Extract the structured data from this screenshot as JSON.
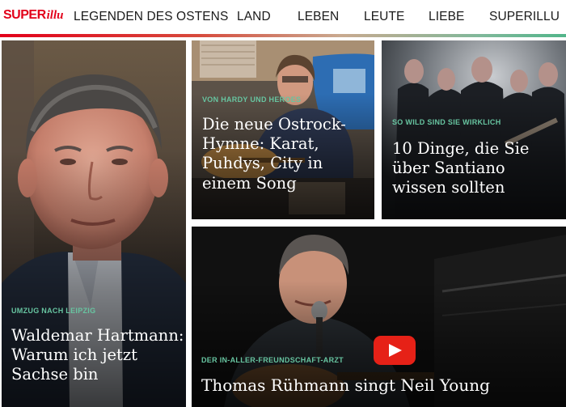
{
  "brand": {
    "part1": "SUPER",
    "part2": "illu"
  },
  "nav": {
    "items": [
      {
        "label": "LEGENDEN DES OSTENS"
      },
      {
        "label": "LAND"
      },
      {
        "label": "LEBEN"
      },
      {
        "label": "LEUTE"
      },
      {
        "label": "LIEBE"
      },
      {
        "label": "SUPERILLU"
      }
    ]
  },
  "teasers": [
    {
      "kicker": "UMZUG NACH LEIPZIG",
      "headline": "Waldemar Hartmann: Warum ich jetzt Sachse bin"
    },
    {
      "kicker": "VON HARDY UND HEROES",
      "headline": "Die neue Ostrock-Hymne: Karat, Puhdys, City in einem Song"
    },
    {
      "kicker": "SO WILD SIND SIE WIRKLICH",
      "headline": "10 Dinge, die Sie über Santiano wissen sollten"
    },
    {
      "kicker": "DER IN-ALLER-FREUNDSCHAFT-ARZT",
      "headline": "Thomas Rühmann singt Neil Young"
    }
  ],
  "colors": {
    "brand": "#e2001a",
    "kicker": "#67c4a0",
    "play": "#e62117"
  },
  "icons": {
    "play": "play-icon"
  }
}
